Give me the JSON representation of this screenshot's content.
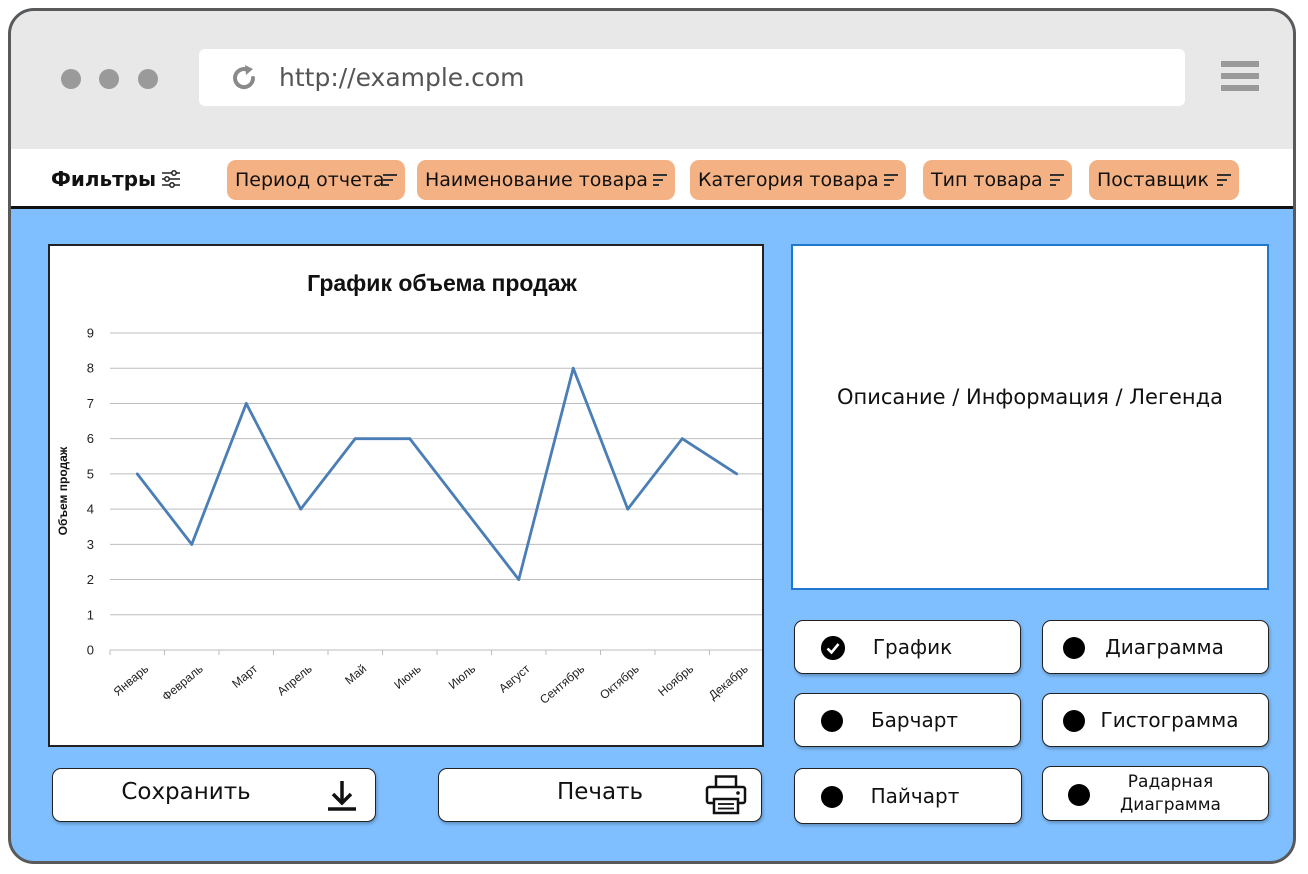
{
  "browser": {
    "url": "http://example.com"
  },
  "filters": {
    "label": "Фильтры",
    "chips": [
      {
        "label": "Период отчета"
      },
      {
        "label": "Наименование товара"
      },
      {
        "label": "Категория товара"
      },
      {
        "label": "Тип товара"
      },
      {
        "label": "Поставщик"
      }
    ]
  },
  "info": {
    "text": "Описание / Информация / Легенда"
  },
  "actions": {
    "save_label": "Сохранить",
    "print_label": "Печать"
  },
  "chart_types": [
    {
      "label": "График",
      "selected": true
    },
    {
      "label": "Диаграмма",
      "selected": false
    },
    {
      "label": "Барчарт",
      "selected": false
    },
    {
      "label": "Гистограмма",
      "selected": false
    },
    {
      "label": "Пайчарт",
      "selected": false
    },
    {
      "label_line1": "Радарная",
      "label_line2": "Диаграмма",
      "selected": false
    }
  ],
  "colors": {
    "accent_background": "#80bfff",
    "chip": "#f4b183",
    "series_line": "#4a7eb5"
  },
  "chart_data": {
    "type": "line",
    "title": "График объема продаж",
    "xlabel": "",
    "ylabel": "Объем продаж",
    "categories": [
      "Январь",
      "Февраль",
      "Март",
      "Апрель",
      "Май",
      "Июнь",
      "Июль",
      "Август",
      "Сентябрь",
      "Октябрь",
      "Ноябрь",
      "Декабрь"
    ],
    "series": [
      {
        "values": [
          5,
          3,
          7,
          4,
          6,
          6,
          4,
          2,
          8,
          4,
          6,
          5
        ]
      }
    ],
    "ylim": [
      0,
      9
    ],
    "yticks": [
      0,
      1,
      2,
      3,
      4,
      5,
      6,
      7,
      8,
      9
    ],
    "grid": true,
    "legend": "none"
  }
}
